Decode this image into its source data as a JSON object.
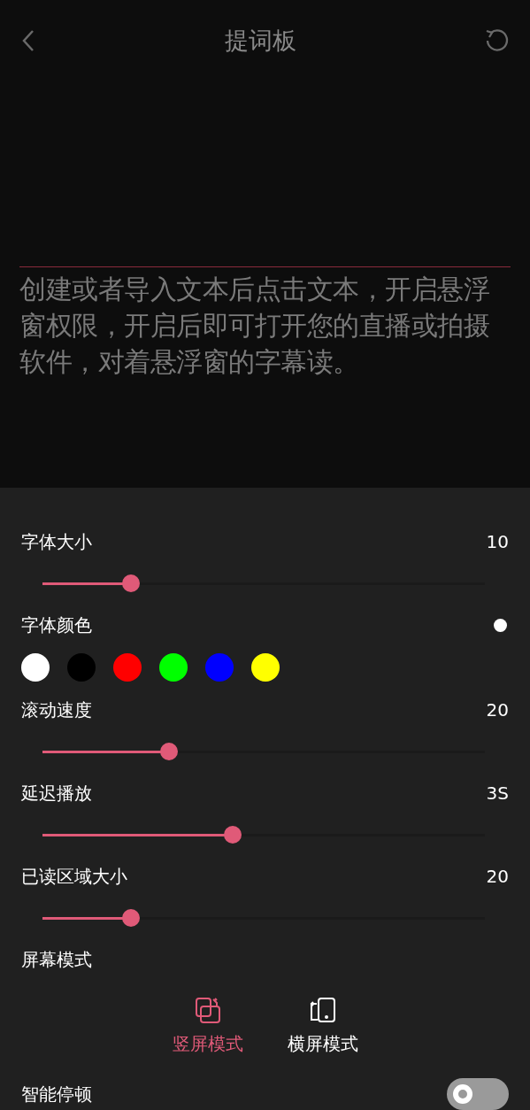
{
  "header": {
    "title": "提词板"
  },
  "prompt_lines": [
    "创建或者导入文本后点击文本，开启悬浮",
    "窗权限，开启后即可打开您的直播或拍摄",
    "软件，对着悬浮窗的字幕读。"
  ],
  "settings": [
    {
      "kind": "slider",
      "label": "字体大小",
      "value": "10",
      "level": 0.2
    },
    {
      "kind": "colors",
      "label": "字体颜色",
      "current": {
        "color": "#ffffff"
      },
      "colors": [
        {
          "color": "#ffffff"
        },
        {
          "color": "#000000"
        },
        {
          "color": "#ff0000"
        },
        {
          "color": "#00ff00"
        },
        {
          "color": "#0000ff"
        },
        {
          "color": "#ffff00"
        }
      ]
    },
    {
      "kind": "slider",
      "label": "滚动速度",
      "value": "20",
      "level": 0.286
    },
    {
      "kind": "slider",
      "label": "延迟播放",
      "value": "3S",
      "level": 0.43
    },
    {
      "kind": "slider",
      "label": "已读区域大小",
      "value": "20",
      "level": 0.2
    },
    {
      "kind": "modes",
      "label": "屏幕模式",
      "options": [
        {
          "label": "竖屏模式",
          "kind": "portrait",
          "selected": true
        },
        {
          "label": "横屏模式",
          "kind": "landscape",
          "selected": false
        }
      ]
    },
    {
      "kind": "toggle",
      "label": "智能停顿",
      "on": false
    }
  ]
}
